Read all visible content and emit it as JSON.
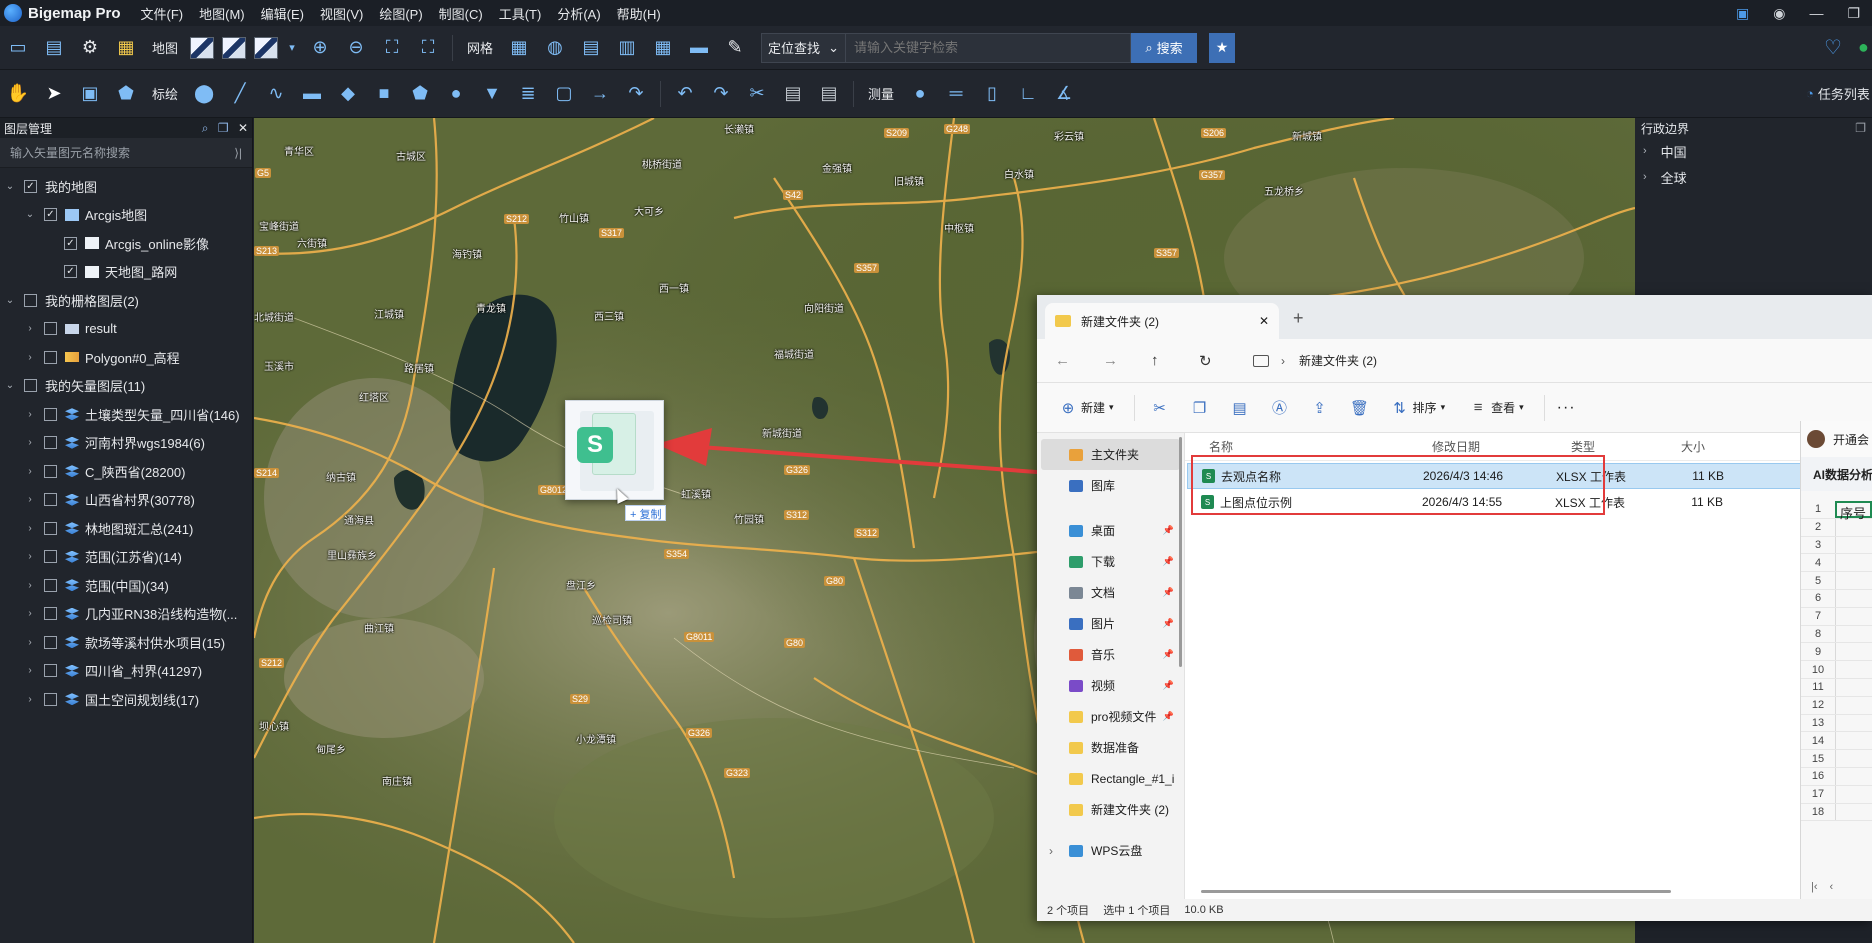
{
  "app": {
    "name": "Bigemap Pro",
    "menu": [
      "文件(F)",
      "地图(M)",
      "编辑(E)",
      "视图(V)",
      "绘图(P)",
      "制图(C)",
      "工具(T)",
      "分析(A)",
      "帮助(H)"
    ]
  },
  "toolbar1": {
    "map_label": "地图",
    "grid_label": "网格",
    "search_type": "定位查找",
    "search_placeholder": "请输入关键字检索",
    "search_button": "搜索"
  },
  "toolbar2": {
    "annotate_label": "标绘",
    "measure_label": "测量",
    "task_list_label": "任务列表"
  },
  "left_panel": {
    "title": "图层管理",
    "search_placeholder": "输入矢量图元名称搜索",
    "tree": [
      {
        "label": "我的地图",
        "level": 0,
        "checked": true,
        "expanded": true,
        "icon": "none"
      },
      {
        "label": "Arcgis地图",
        "level": 1,
        "checked": true,
        "expanded": true,
        "icon": "map"
      },
      {
        "label": "Arcgis_online影像",
        "level": 2,
        "checked": true,
        "icon": "map-white"
      },
      {
        "label": "天地图_路网",
        "level": 2,
        "checked": true,
        "icon": "map-white"
      },
      {
        "label": "我的栅格图层(2)",
        "level": 0,
        "checked": false,
        "expanded": true,
        "icon": "none"
      },
      {
        "label": "result",
        "level": 1,
        "checked": false,
        "expanded": false,
        "icon": "raster"
      },
      {
        "label": "Polygon#0_高程",
        "level": 1,
        "checked": false,
        "expanded": false,
        "icon": "poly"
      },
      {
        "label": "我的矢量图层(11)",
        "level": 0,
        "checked": false,
        "expanded": true,
        "icon": "none"
      },
      {
        "label": "土壤类型矢量_四川省(146)",
        "level": 1,
        "checked": false,
        "expanded": false,
        "icon": "stack"
      },
      {
        "label": "河南村界wgs1984(6)",
        "level": 1,
        "checked": false,
        "expanded": false,
        "icon": "stack"
      },
      {
        "label": "C_陕西省(28200)",
        "level": 1,
        "checked": false,
        "expanded": false,
        "icon": "stack"
      },
      {
        "label": "山西省村界(30778)",
        "level": 1,
        "checked": false,
        "expanded": false,
        "icon": "stack"
      },
      {
        "label": "林地图斑汇总(241)",
        "level": 1,
        "checked": false,
        "expanded": false,
        "icon": "stack"
      },
      {
        "label": "范围(江苏省)(14)",
        "level": 1,
        "checked": false,
        "expanded": false,
        "icon": "stack"
      },
      {
        "label": "范围(中国)(34)",
        "level": 1,
        "checked": false,
        "expanded": false,
        "icon": "stack"
      },
      {
        "label": "几内亚RN38沿线构造物(...",
        "level": 1,
        "checked": false,
        "expanded": false,
        "icon": "stack"
      },
      {
        "label": "款场等溪村供水项目(15)",
        "level": 1,
        "checked": false,
        "expanded": false,
        "icon": "stack"
      },
      {
        "label": "四川省_村界(41297)",
        "level": 1,
        "checked": false,
        "expanded": false,
        "icon": "stack"
      },
      {
        "label": "国土空间规划线(17)",
        "level": 1,
        "checked": false,
        "expanded": false,
        "icon": "stack"
      }
    ]
  },
  "right_panel": {
    "title": "行政边界",
    "items": [
      "中国",
      "全球"
    ]
  },
  "map": {
    "labels": [
      {
        "t": "青华区"
      },
      {
        "t": "古城区"
      },
      {
        "t": "长濑镇"
      },
      {
        "t": "桃桥街道"
      },
      {
        "t": "大可乡"
      },
      {
        "t": "旧城镇"
      },
      {
        "t": "金强镇"
      },
      {
        "t": "白水镇"
      },
      {
        "t": "彩云镇"
      },
      {
        "t": "五龙桥乡"
      },
      {
        "t": "竹山镇"
      },
      {
        "t": "海钓镇"
      },
      {
        "t": "六街镇"
      },
      {
        "t": "宝峰街道"
      },
      {
        "t": "西一镇"
      },
      {
        "t": "西三镇"
      },
      {
        "t": "青龙镇"
      },
      {
        "t": "北城街道"
      },
      {
        "t": "江城镇"
      },
      {
        "t": "玉溪市"
      },
      {
        "t": "路居镇"
      },
      {
        "t": "红塔区"
      },
      {
        "t": "新城街道"
      },
      {
        "t": "五山乡"
      },
      {
        "t": "虹溪镇"
      },
      {
        "t": "竹园镇"
      },
      {
        "t": "纳古镇"
      },
      {
        "t": "通海县"
      },
      {
        "t": "里山彝族乡"
      },
      {
        "t": "盘江乡"
      },
      {
        "t": "巡检司镇"
      },
      {
        "t": "曲江镇"
      },
      {
        "t": "坝心镇"
      },
      {
        "t": "小龙潭镇"
      },
      {
        "t": "甸尾乡"
      },
      {
        "t": "南庄镇"
      },
      {
        "t": "新城镇"
      },
      {
        "t": "中枢镇"
      },
      {
        "t": "向阳街道"
      },
      {
        "t": "福城街道"
      }
    ],
    "roads": [
      "G5",
      "S42",
      "S209",
      "G248",
      "S357",
      "S206",
      "G357",
      "S212",
      "S317",
      "G8012",
      "G326",
      "S312",
      "G80",
      "S354",
      "G8011",
      "S29",
      "S212",
      "G80",
      "G326",
      "G323",
      "S214",
      "S213",
      "S357",
      "S312"
    ]
  },
  "drag": {
    "copy_label": "+ 复制"
  },
  "explorer": {
    "tab_title": "新建文件夹 (2)",
    "breadcrumb": "新建文件夹 (2)",
    "cmd": {
      "new": "新建",
      "sort": "排序",
      "view": "查看"
    },
    "nav_items": [
      {
        "label": "主文件夹",
        "selected": true,
        "color": "#e9a13b"
      },
      {
        "label": "图库",
        "selected": false,
        "color": "#3a6fc0"
      },
      {
        "label": "桌面",
        "pin": true,
        "color": "#3a8fd6"
      },
      {
        "label": "下载",
        "pin": true,
        "color": "#2e9d6b"
      },
      {
        "label": "文档",
        "pin": true,
        "color": "#7b8794"
      },
      {
        "label": "图片",
        "pin": true,
        "color": "#3a6fc0"
      },
      {
        "label": "音乐",
        "pin": true,
        "color": "#e05a3b"
      },
      {
        "label": "视频",
        "pin": true,
        "color": "#7a4bc8"
      },
      {
        "label": "pro视频文件",
        "pin": true,
        "color": "#f2c94c"
      },
      {
        "label": "数据准备",
        "pin": false,
        "color": "#f2c94c"
      },
      {
        "label": "Rectangle_#1_i",
        "pin": false,
        "color": "#f2c94c"
      },
      {
        "label": "新建文件夹 (2)",
        "pin": false,
        "color": "#f2c94c"
      },
      {
        "label": "WPS云盘",
        "pin": false,
        "color": "#3a8fd6"
      }
    ],
    "columns": [
      "名称",
      "修改日期",
      "类型",
      "大小"
    ],
    "files": [
      {
        "name": "去观点名称",
        "date": "2026/4/3 14:46",
        "type": "XLSX 工作表",
        "size": "11 KB",
        "selected": true
      },
      {
        "name": "上图点位示例",
        "date": "2026/4/3 14:55",
        "type": "XLSX 工作表",
        "size": "11 KB",
        "selected": false
      }
    ],
    "status": {
      "count": "2 个项目",
      "selected": "选中 1 个项目",
      "size": "10.0 KB"
    }
  },
  "sheet": {
    "top_label": "开通会",
    "ai_label": "AI数据分析",
    "header_cell": "序号",
    "rows": [
      "1",
      "2",
      "3",
      "4",
      "5",
      "6",
      "7",
      "8",
      "9",
      "10",
      "11",
      "12",
      "13",
      "14",
      "15",
      "16",
      "17",
      "18"
    ]
  },
  "colors": {
    "accent": "#3d6fb5",
    "annotation_red": "#e23b3b",
    "excel_green": "#1f8a52"
  }
}
